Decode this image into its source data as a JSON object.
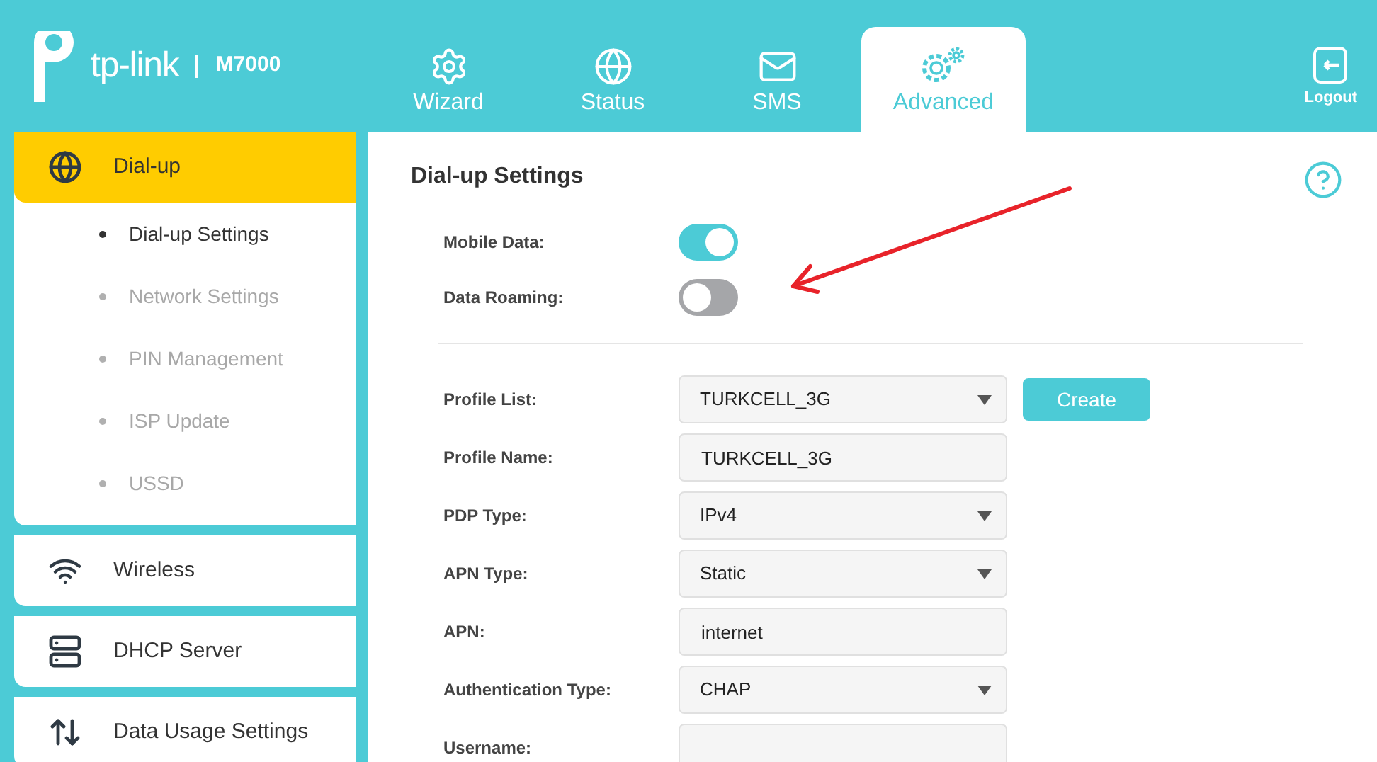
{
  "header": {
    "brand": "tp-link",
    "model": "M7000",
    "logout": "Logout"
  },
  "tabs": [
    {
      "label": "Wizard",
      "selected": false
    },
    {
      "label": "Status",
      "selected": false
    },
    {
      "label": "SMS",
      "selected": false
    },
    {
      "label": "Advanced",
      "selected": true
    }
  ],
  "sidebar": {
    "items": [
      {
        "label": "Dial-up",
        "selected": true,
        "children": [
          {
            "label": "Dial-up Settings",
            "selected": true
          },
          {
            "label": "Network Settings",
            "selected": false
          },
          {
            "label": "PIN Management",
            "selected": false
          },
          {
            "label": "ISP Update",
            "selected": false
          },
          {
            "label": "USSD",
            "selected": false
          }
        ]
      },
      {
        "label": "Wireless",
        "selected": false
      },
      {
        "label": "DHCP Server",
        "selected": false
      },
      {
        "label": "Data Usage Settings",
        "selected": false
      }
    ]
  },
  "panel": {
    "title": "Dial-up Settings",
    "toggles": [
      {
        "label": "Mobile Data:",
        "on": true
      },
      {
        "label": "Data Roaming:",
        "on": false
      }
    ],
    "fields": [
      {
        "label": "Profile List:",
        "kind": "select",
        "value": "TURKCELL_3G"
      },
      {
        "label": "Profile Name:",
        "kind": "text",
        "value": "TURKCELL_3G"
      },
      {
        "label": "PDP Type:",
        "kind": "select",
        "value": "IPv4"
      },
      {
        "label": "APN Type:",
        "kind": "select",
        "value": "Static"
      },
      {
        "label": "APN:",
        "kind": "text",
        "value": "internet"
      },
      {
        "label": "Authentication Type:",
        "kind": "select",
        "value": "CHAP"
      },
      {
        "label": "Username:",
        "kind": "text"
      }
    ],
    "create_button": "Create"
  }
}
